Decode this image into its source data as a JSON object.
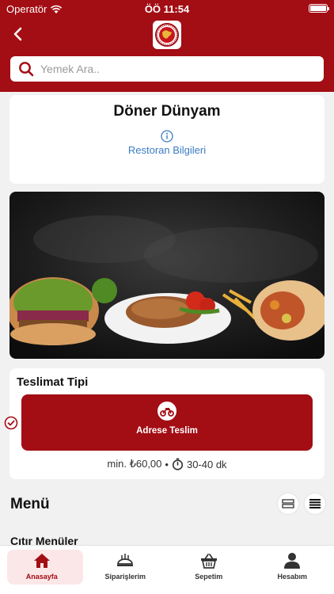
{
  "status": {
    "carrier": "Operatör",
    "time": "ÖÖ 11:54"
  },
  "header": {
    "back_icon": "chevron-left-icon",
    "logo_icon": "restaurant-logo-icon"
  },
  "search": {
    "placeholder": "Yemek Ara..",
    "icon": "search-icon"
  },
  "restaurant": {
    "name": "Döner Dünyam",
    "info_link": "Restoran Bilgileri"
  },
  "delivery": {
    "title": "Teslimat Tipi",
    "option_label": "Adrese Teslim",
    "min_order": "min. ₺60,00",
    "separator": "•",
    "eta": "30-40 dk"
  },
  "menu": {
    "title": "Menü",
    "first_category": "Çıtır Menüler"
  },
  "tabs": [
    {
      "label": "Anasayfa",
      "icon": "home-icon",
      "active": true
    },
    {
      "label": "Siparişlerim",
      "icon": "orders-icon",
      "active": false
    },
    {
      "label": "Sepetim",
      "icon": "basket-icon",
      "active": false
    },
    {
      "label": "Hesabım",
      "icon": "user-icon",
      "active": false
    }
  ],
  "colors": {
    "brand": "#a30d14",
    "link": "#3a7cc4",
    "background": "#f1f1f1"
  }
}
